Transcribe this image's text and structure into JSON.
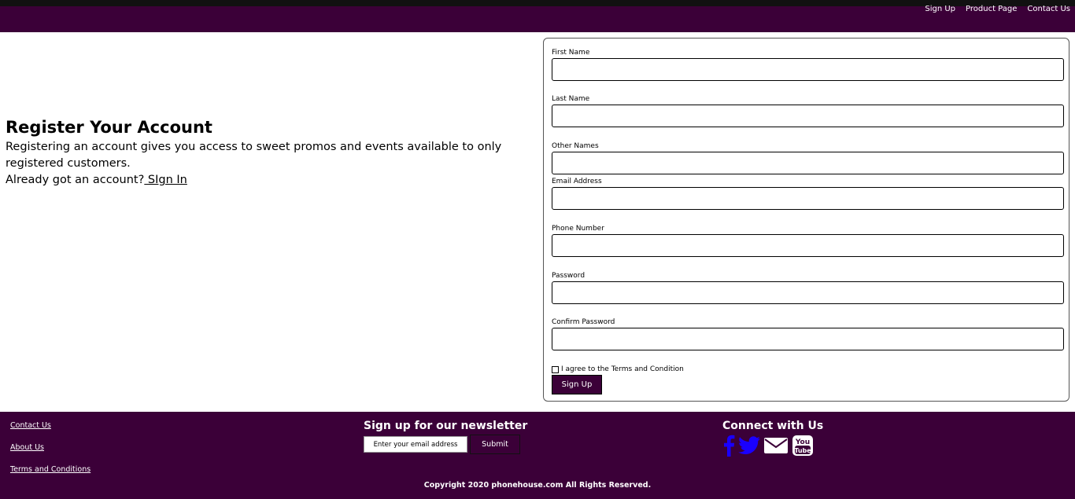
{
  "nav": {
    "links": [
      "Sign Up",
      "Product Page",
      "Contact Us"
    ]
  },
  "intro": {
    "title": "Register Your Account",
    "description": "Registering an account gives you access to sweet promos and events available to only registered customers.",
    "prompt": "Already got an account?",
    "signin_label": " SIgn In"
  },
  "form": {
    "fields": [
      {
        "label": "First Name",
        "value": ""
      },
      {
        "label": "Last Name",
        "value": ""
      },
      {
        "label": "Other Names",
        "value": ""
      },
      {
        "label": "Email Address",
        "value": ""
      },
      {
        "label": "Phone Number",
        "value": ""
      },
      {
        "label": "Password",
        "value": ""
      },
      {
        "label": "Confirm Password",
        "value": ""
      }
    ],
    "terms_label": "I agree to the Terms and Condition",
    "terms_checked": false,
    "submit_label": "Sign Up"
  },
  "footer": {
    "links": [
      "Contact Us",
      "About Us",
      "Terms and Conditions"
    ],
    "newsletter": {
      "title": "Sign up for our newsletter",
      "placeholder": "Enter your email address",
      "submit_label": "Submit"
    },
    "connect": {
      "title": "Connect with Us",
      "icons": [
        "facebook-icon",
        "twitter-icon",
        "email-icon",
        "youtube-icon"
      ]
    },
    "copyright": "Copyright 2020 phonehouse.com All Rights Reserved."
  },
  "colors": {
    "brand": "#3b0038",
    "social_blue": "#1a00ff",
    "white": "#ffffff"
  }
}
